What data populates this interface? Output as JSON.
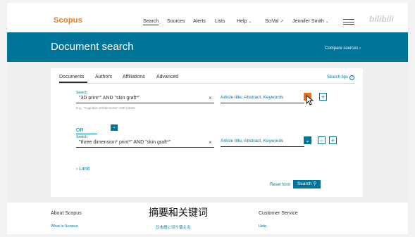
{
  "header": {
    "logo": "Scopus",
    "nav": [
      {
        "label": "Search",
        "active": true
      },
      {
        "label": "Sources"
      },
      {
        "label": "Alerts"
      },
      {
        "label": "Lists"
      },
      {
        "label": "Help"
      },
      {
        "label": "SciVal"
      },
      {
        "label": "Jennifer Smith"
      }
    ],
    "watermark": "bilibili"
  },
  "banner": {
    "title": "Document search",
    "compare_link": "Compare sources"
  },
  "tabs": [
    "Documents",
    "Authors",
    "Affiliations",
    "Advanced"
  ],
  "search_tips": "Search tips",
  "rows": [
    {
      "label": "Search",
      "value": "\"3D print*\" AND \"skin graft*\"",
      "hint": "E.g., \"Cognitive architectures\" AND robots",
      "scope": "Article title, Abstract, Keywords"
    },
    {
      "label": "Search",
      "value": "\"three dimension* print*\" AND \"skin graft*\"",
      "scope": "Article title, Abstract, Keywords"
    }
  ],
  "operator": "OR",
  "limit": "Limit",
  "reset": "Reset form",
  "search_button": "Search",
  "footer": {
    "about": "About Scopus",
    "what_is": "What is Scopus",
    "language": "Language",
    "language_link": "日本語に切り替える",
    "customer_service": "Customer Service",
    "help": "Help"
  },
  "subtitle": "摘要和关键词",
  "colors": {
    "brand_orange": "#e87722",
    "accent_blue": "#007398",
    "active_button": "#e9711c"
  }
}
